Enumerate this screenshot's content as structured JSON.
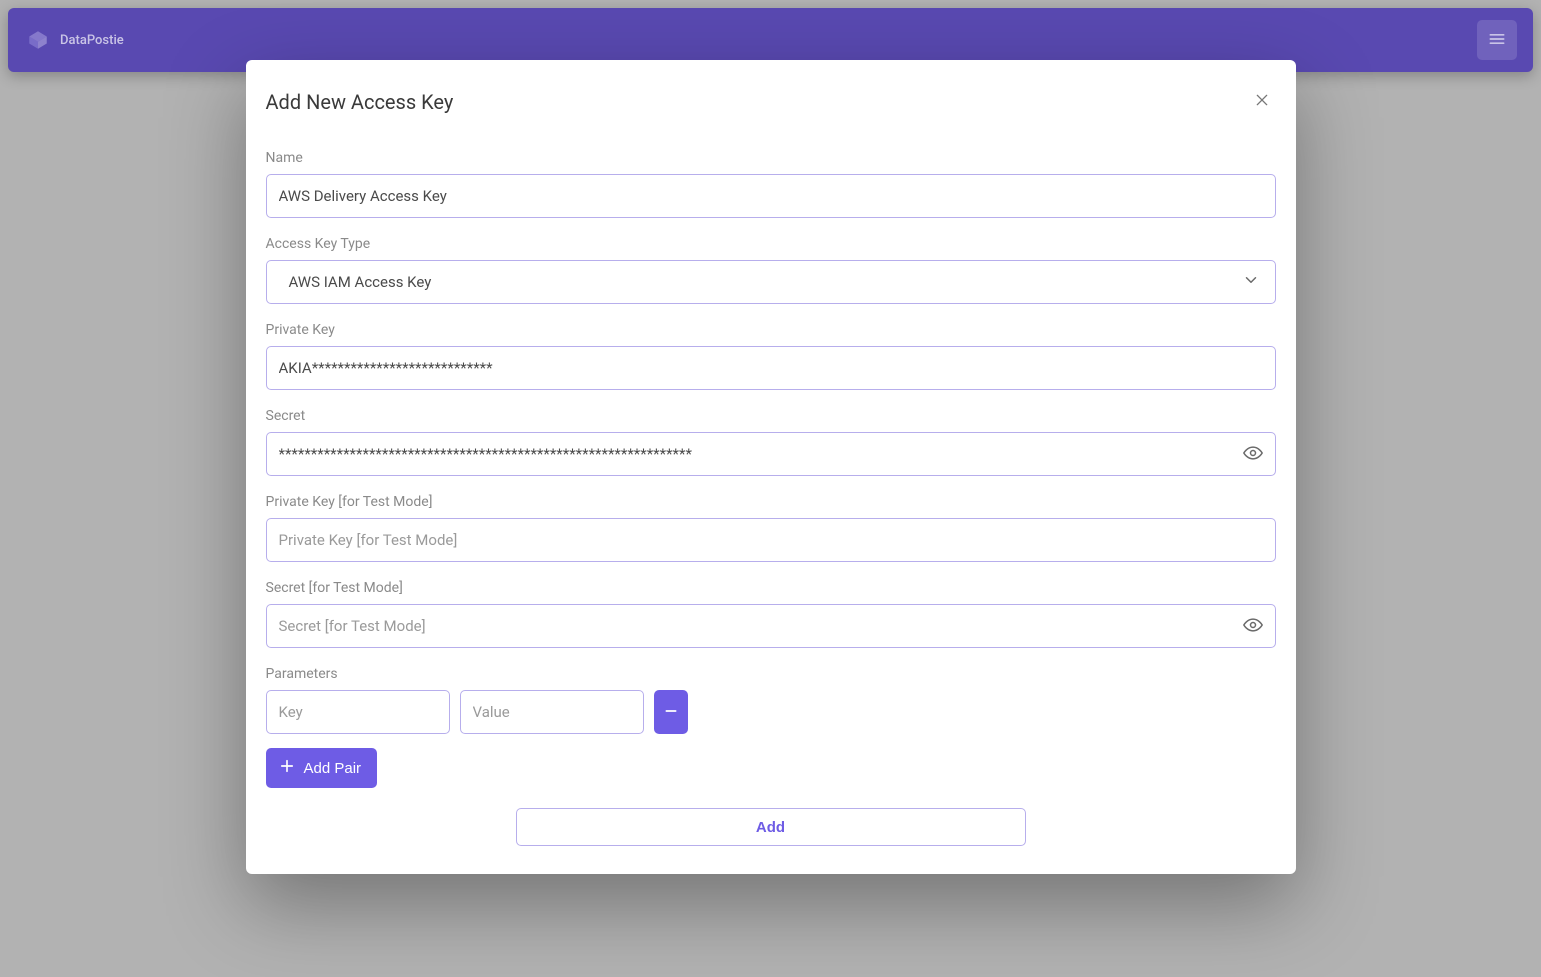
{
  "header": {
    "brand": "DataPostie"
  },
  "modal": {
    "title": "Add New Access Key",
    "fields": {
      "name": {
        "label": "Name",
        "value": "AWS Delivery Access Key"
      },
      "type": {
        "label": "Access Key Type",
        "value": "AWS IAM Access Key"
      },
      "privateKey": {
        "label": "Private Key",
        "value": "AKIA****************************"
      },
      "secret": {
        "label": "Secret",
        "value": "****************************************************************"
      },
      "privateKeyTest": {
        "label": "Private Key [for Test Mode]",
        "placeholder": "Private Key [for Test Mode]"
      },
      "secretTest": {
        "label": "Secret [for Test Mode]",
        "placeholder": "Secret [for Test Mode]"
      },
      "parameters": {
        "label": "Parameters",
        "keyPlaceholder": "Key",
        "valuePlaceholder": "Value"
      }
    },
    "buttons": {
      "addPair": "Add Pair",
      "submit": "Add"
    }
  }
}
